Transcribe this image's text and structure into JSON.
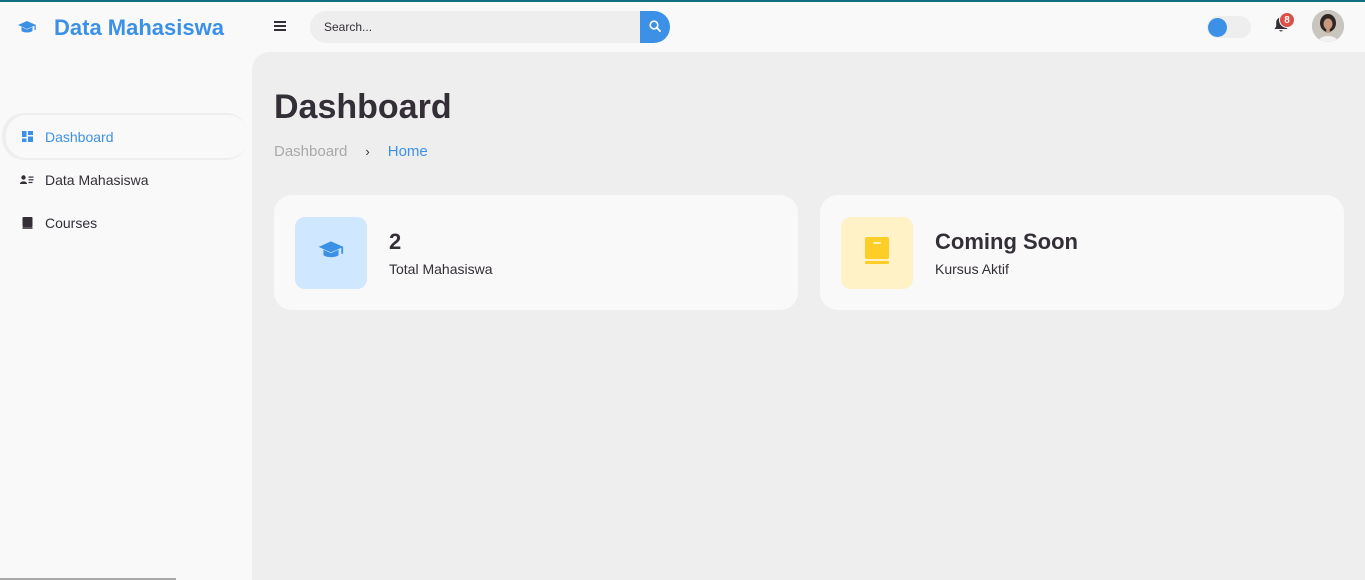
{
  "brand": {
    "title": "Data Mahasiswa",
    "icon": "graduation-cap-icon"
  },
  "sidebar": {
    "items": [
      {
        "label": "Dashboard",
        "icon": "dashboard-grid-icon",
        "active": true
      },
      {
        "label": "Data Mahasiswa",
        "icon": "user-list-icon",
        "active": false
      },
      {
        "label": "Courses",
        "icon": "book-icon",
        "active": false
      }
    ]
  },
  "topbar": {
    "menu_icon": "hamburger-icon",
    "search": {
      "placeholder": "Search...",
      "value": "",
      "button_icon": "search-icon"
    },
    "theme_toggle": {
      "state": "off"
    },
    "notifications": {
      "icon": "bell-icon",
      "count": "8"
    },
    "avatar": {
      "icon": "user-avatar"
    }
  },
  "main": {
    "title": "Dashboard",
    "breadcrumb": {
      "first": "Dashboard",
      "separator": "›",
      "current": "Home"
    },
    "cards": [
      {
        "value": "2",
        "label": "Total Mahasiswa",
        "icon": "graduation-cap-icon",
        "icon_bg": "#cfe8ff",
        "icon_color": "#3c91e6"
      },
      {
        "value": "Coming Soon",
        "label": "Kursus Aktif",
        "icon": "book-icon",
        "icon_bg": "#fff2c6",
        "icon_color": "#ffce26"
      }
    ]
  },
  "colors": {
    "accent": "#3c91e6",
    "sidebar_bg": "#f9f9f9",
    "content_bg": "#eeeeee",
    "text": "#342e37",
    "badge": "#db504a",
    "top_line": "#126e82"
  }
}
